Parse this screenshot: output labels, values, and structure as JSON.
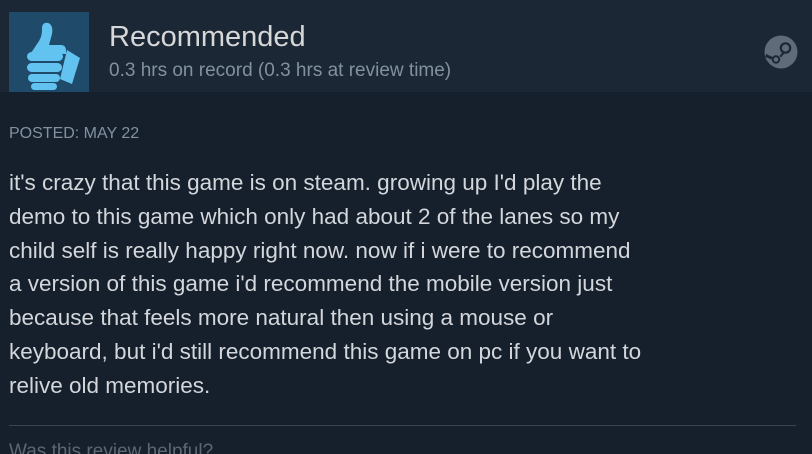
{
  "header": {
    "icon": "thumbs-up-icon",
    "title": "Recommended",
    "hours": "0.3 hrs on record (0.3 hrs at review time)",
    "platform_icon": "steam-logo-icon"
  },
  "posted": "POSTED: MAY 22",
  "review": {
    "lines": [
      "it's crazy that this game is on steam. growing up I'd play the",
      "demo to this game which only had about 2 of the lanes so my",
      "child self is really happy right now. now if i were to recommend",
      "a version of this game i'd recommend the mobile version just",
      "because that feels more natural then using a mouse or",
      "keyboard, but i'd still recommend this game on pc if you want to",
      "relive old memories."
    ]
  },
  "footer": {
    "helpful_prompt": "Was this review helpful?"
  },
  "colors": {
    "background": "#16202d",
    "header_background": "#1c2735",
    "thumb_box": "#1f4a69",
    "thumb_accent": "#62c3f1",
    "title_text": "#d6d7d8",
    "meta_text": "#8191a0",
    "body_text": "#d3d6da"
  }
}
